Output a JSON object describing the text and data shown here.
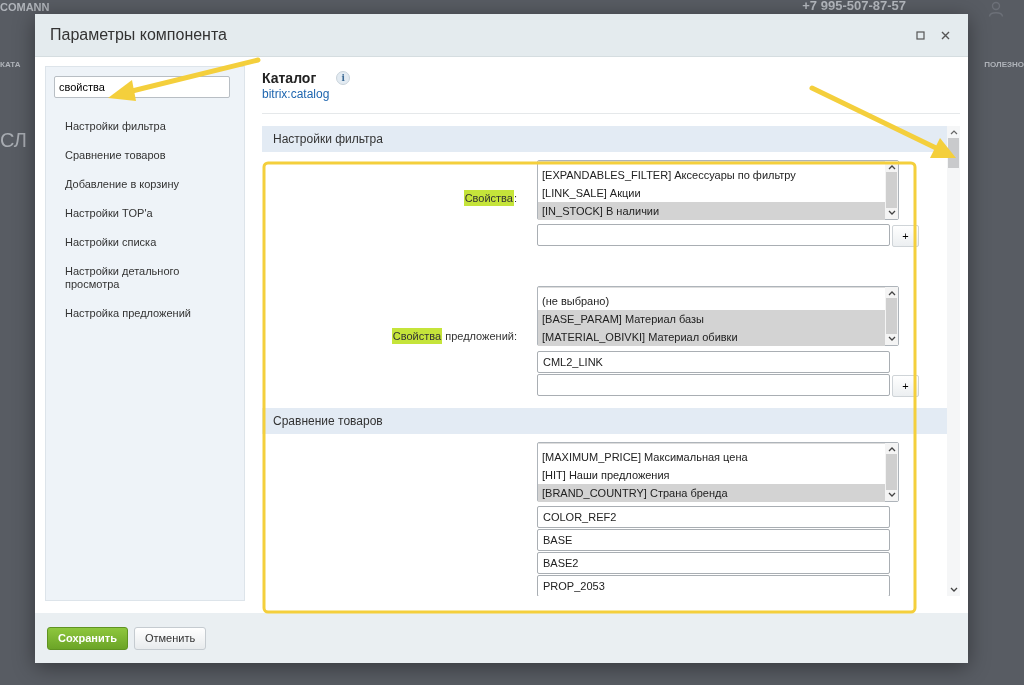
{
  "background": {
    "logo": "COMANN",
    "phone": "+7 995-507-87-57",
    "nav_left": "КАТА",
    "nav_right": "ПОЛЕЗНО",
    "heading": "СЛ"
  },
  "dialog": {
    "title": "Параметры компонента"
  },
  "sidebar": {
    "search": {
      "value": "свойства"
    },
    "items": [
      {
        "label": "Настройки фильтра"
      },
      {
        "label": "Сравнение товаров"
      },
      {
        "label": "Добавление в корзину"
      },
      {
        "label": "Настройки TOP'а"
      },
      {
        "label": "Настройки списка"
      },
      {
        "label": "Настройки детального просмотра"
      },
      {
        "label": "Настройка предложений"
      }
    ]
  },
  "component": {
    "name": "Каталог",
    "info": "i",
    "code": "bitrix:catalog"
  },
  "sections": [
    {
      "title": "Настройки фильтра",
      "params": [
        {
          "label": [
            {
              "text": "Свойства",
              "highlighted": true
            },
            {
              "text": ":",
              "highlighted": false
            }
          ],
          "options": [
            {
              "label": "[EXPANDABLES_FILTER] Аксессуары по фильтру",
              "selected": false
            },
            {
              "label": "[LINK_SALE] Акции",
              "selected": false
            },
            {
              "label": "[IN_STOCK] В наличии",
              "selected": true
            }
          ],
          "fields": [
            {
              "kind": "input"
            }
          ],
          "add_button": "+"
        },
        {
          "label": [
            {
              "text": "Свойства",
              "highlighted": true
            },
            {
              "text": " предложений:",
              "highlighted": false
            }
          ],
          "options": [
            {
              "label": "(не выбрано)",
              "selected": false
            },
            {
              "label": "[BASE_PARAM] Материал базы",
              "selected": true
            },
            {
              "label": "[MATERIAL_OBIVKI] Материал обивки",
              "selected": true
            }
          ],
          "fields": [
            {
              "kind": "input",
              "value": "CML2_LINK"
            },
            {
              "kind": "input"
            }
          ],
          "add_button": "+"
        }
      ]
    },
    {
      "title": "Сравнение товаров",
      "params": [
        {
          "options": [
            {
              "label": "[MAXIMUM_PRICE] Максимальная цена",
              "selected": false
            },
            {
              "label": "[HIT] Наши предложения",
              "selected": false
            },
            {
              "label": "[BRAND_COUNTRY] Страна бренда",
              "selected": true
            }
          ],
          "fields": [
            {
              "kind": "input",
              "value": "COLOR_REF2"
            },
            {
              "kind": "input",
              "value": "BASE"
            },
            {
              "kind": "input",
              "value": "BASE2"
            },
            {
              "kind": "input",
              "value": "PROP_2053"
            }
          ]
        }
      ]
    }
  ],
  "footer": {
    "buttons": [
      {
        "label": "Сохранить",
        "kind": "primary"
      },
      {
        "label": "Отменить",
        "kind": "secondary"
      }
    ]
  }
}
